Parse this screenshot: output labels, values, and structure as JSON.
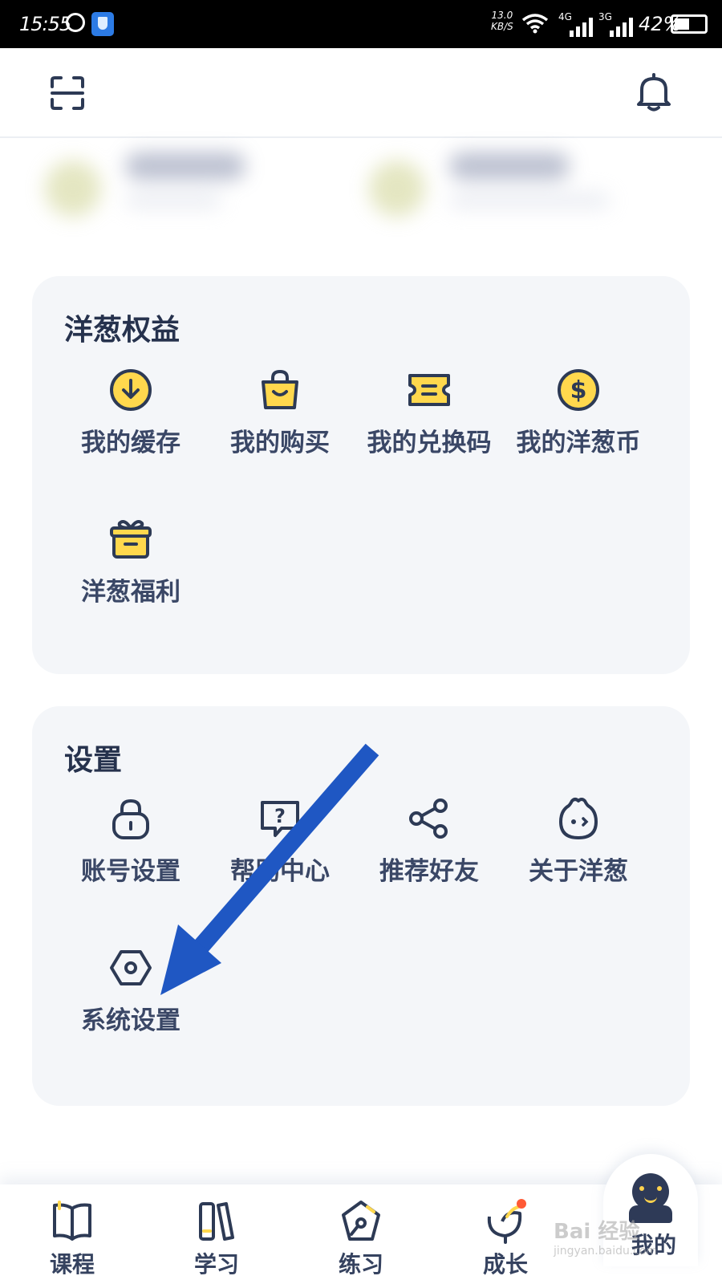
{
  "status_bar": {
    "time": "15:55",
    "speed_value": "13.0",
    "speed_unit": "KB/S",
    "network_4g": "4G",
    "network_3g": "3G",
    "battery": "42%"
  },
  "rights": {
    "title": "洋葱权益",
    "items": [
      {
        "label": "我的缓存",
        "icon": "download-circle-icon"
      },
      {
        "label": "我的购买",
        "icon": "shopping-bag-icon"
      },
      {
        "label": "我的兑换码",
        "icon": "ticket-icon"
      },
      {
        "label": "我的洋葱币",
        "icon": "coin-icon"
      },
      {
        "label": "洋葱福利",
        "icon": "gift-icon"
      }
    ]
  },
  "settings": {
    "title": "设置",
    "items": [
      {
        "label": "账号设置",
        "icon": "lock-icon"
      },
      {
        "label": "帮助中心",
        "icon": "help-bubble-icon"
      },
      {
        "label": "推荐好友",
        "icon": "share-icon"
      },
      {
        "label": "关于洋葱",
        "icon": "onion-icon"
      },
      {
        "label": "系统设置",
        "icon": "hex-gear-icon"
      }
    ]
  },
  "bottom_nav": {
    "items": [
      {
        "label": "课程",
        "icon": "book-icon"
      },
      {
        "label": "学习",
        "icon": "study-icon"
      },
      {
        "label": "练习",
        "icon": "pen-icon"
      },
      {
        "label": "成长",
        "icon": "growth-icon"
      },
      {
        "label": "我的",
        "icon": "mascot-icon"
      }
    ],
    "active": "我的"
  },
  "watermark": {
    "brand": "Bai 经验",
    "url": "jingyan.baidu.com"
  },
  "colors": {
    "icon_yellow": "#ffd84d",
    "icon_stroke": "#2d3a55",
    "card_bg": "#f4f6f9",
    "arrow_blue": "#1f57c3",
    "badge_red": "#ff5a36"
  }
}
